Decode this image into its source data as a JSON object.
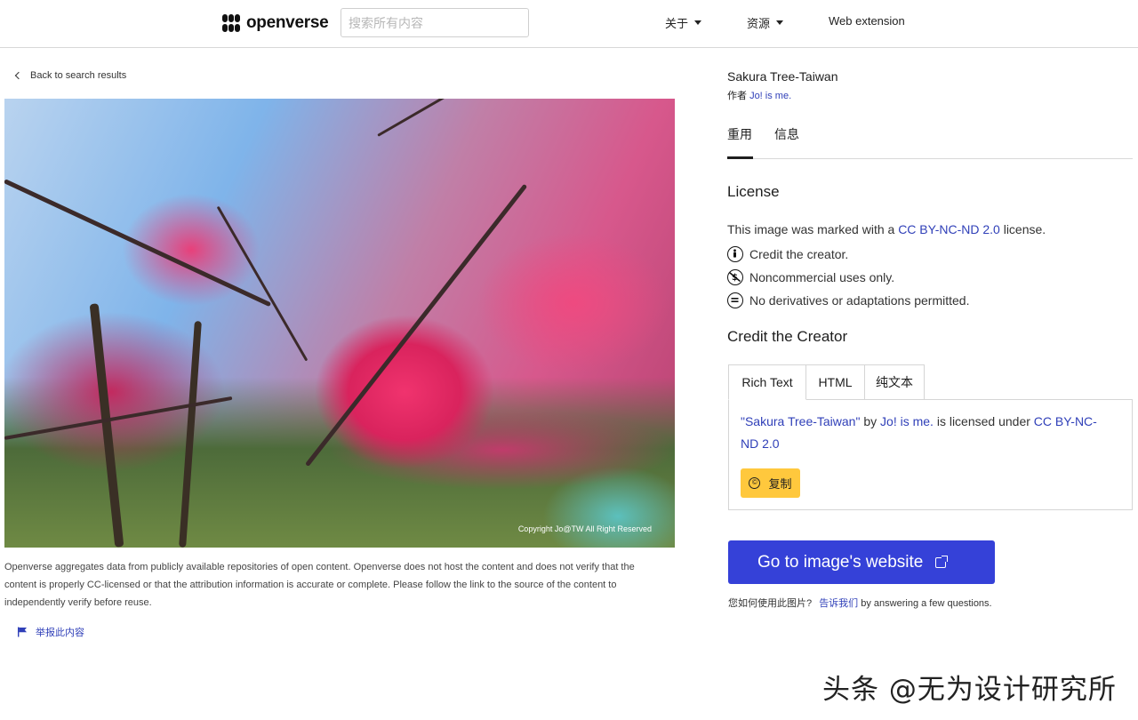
{
  "header": {
    "logo_text": "openverse",
    "search_placeholder": "搜索所有内容",
    "nav": {
      "about": "关于",
      "resources": "资源",
      "extension": "Web extension"
    }
  },
  "left": {
    "back_link": "Back to search results",
    "photo_copyright": "Copyright  Jo@TW All  Right Reserved",
    "disclaimer": "Openverse aggregates data from publicly available repositories of open content. Openverse does not host the content and does not verify that the content is properly CC-licensed or that the attribution information is accurate or complete. Please follow the link to the source of the content to independently verify before reuse.",
    "report": "举报此内容"
  },
  "image": {
    "title": "Sakura Tree-Taiwan",
    "author_prefix": "作者 ",
    "author": "Jo! is me."
  },
  "tabs": [
    "重用",
    "信息"
  ],
  "license": {
    "heading": "License",
    "line_prefix": "This image was marked with a ",
    "license_name": "CC BY-NC-ND 2.0",
    "line_suffix": " license.",
    "items": [
      {
        "icon": "cc-by-icon",
        "text": "Credit the creator."
      },
      {
        "icon": "cc-nc-icon",
        "text": "Noncommercial uses only."
      },
      {
        "icon": "cc-nd-icon",
        "text": "No derivatives or adaptations permitted."
      }
    ]
  },
  "credit": {
    "heading": "Credit the Creator",
    "tabs": [
      "Rich Text",
      "HTML",
      "纯文本"
    ],
    "quoted_title": "\"Sakura Tree-Taiwan\"",
    "by": " by ",
    "author": "Jo! is me.",
    "licensed_under": " is licensed under ",
    "license": "CC BY-NC-ND 2.0",
    "copy_button": "复制"
  },
  "go_button": "Go to image's website",
  "feedback": {
    "question": "您如何使用此图片?",
    "link": "告诉我们",
    "suffix": " by answering a few questions."
  },
  "watermark": "头条 @无为设计研究所",
  "colors": {
    "link": "#2f3fb8",
    "primary_button": "#3541d8",
    "copy_button": "#ffc83d"
  }
}
